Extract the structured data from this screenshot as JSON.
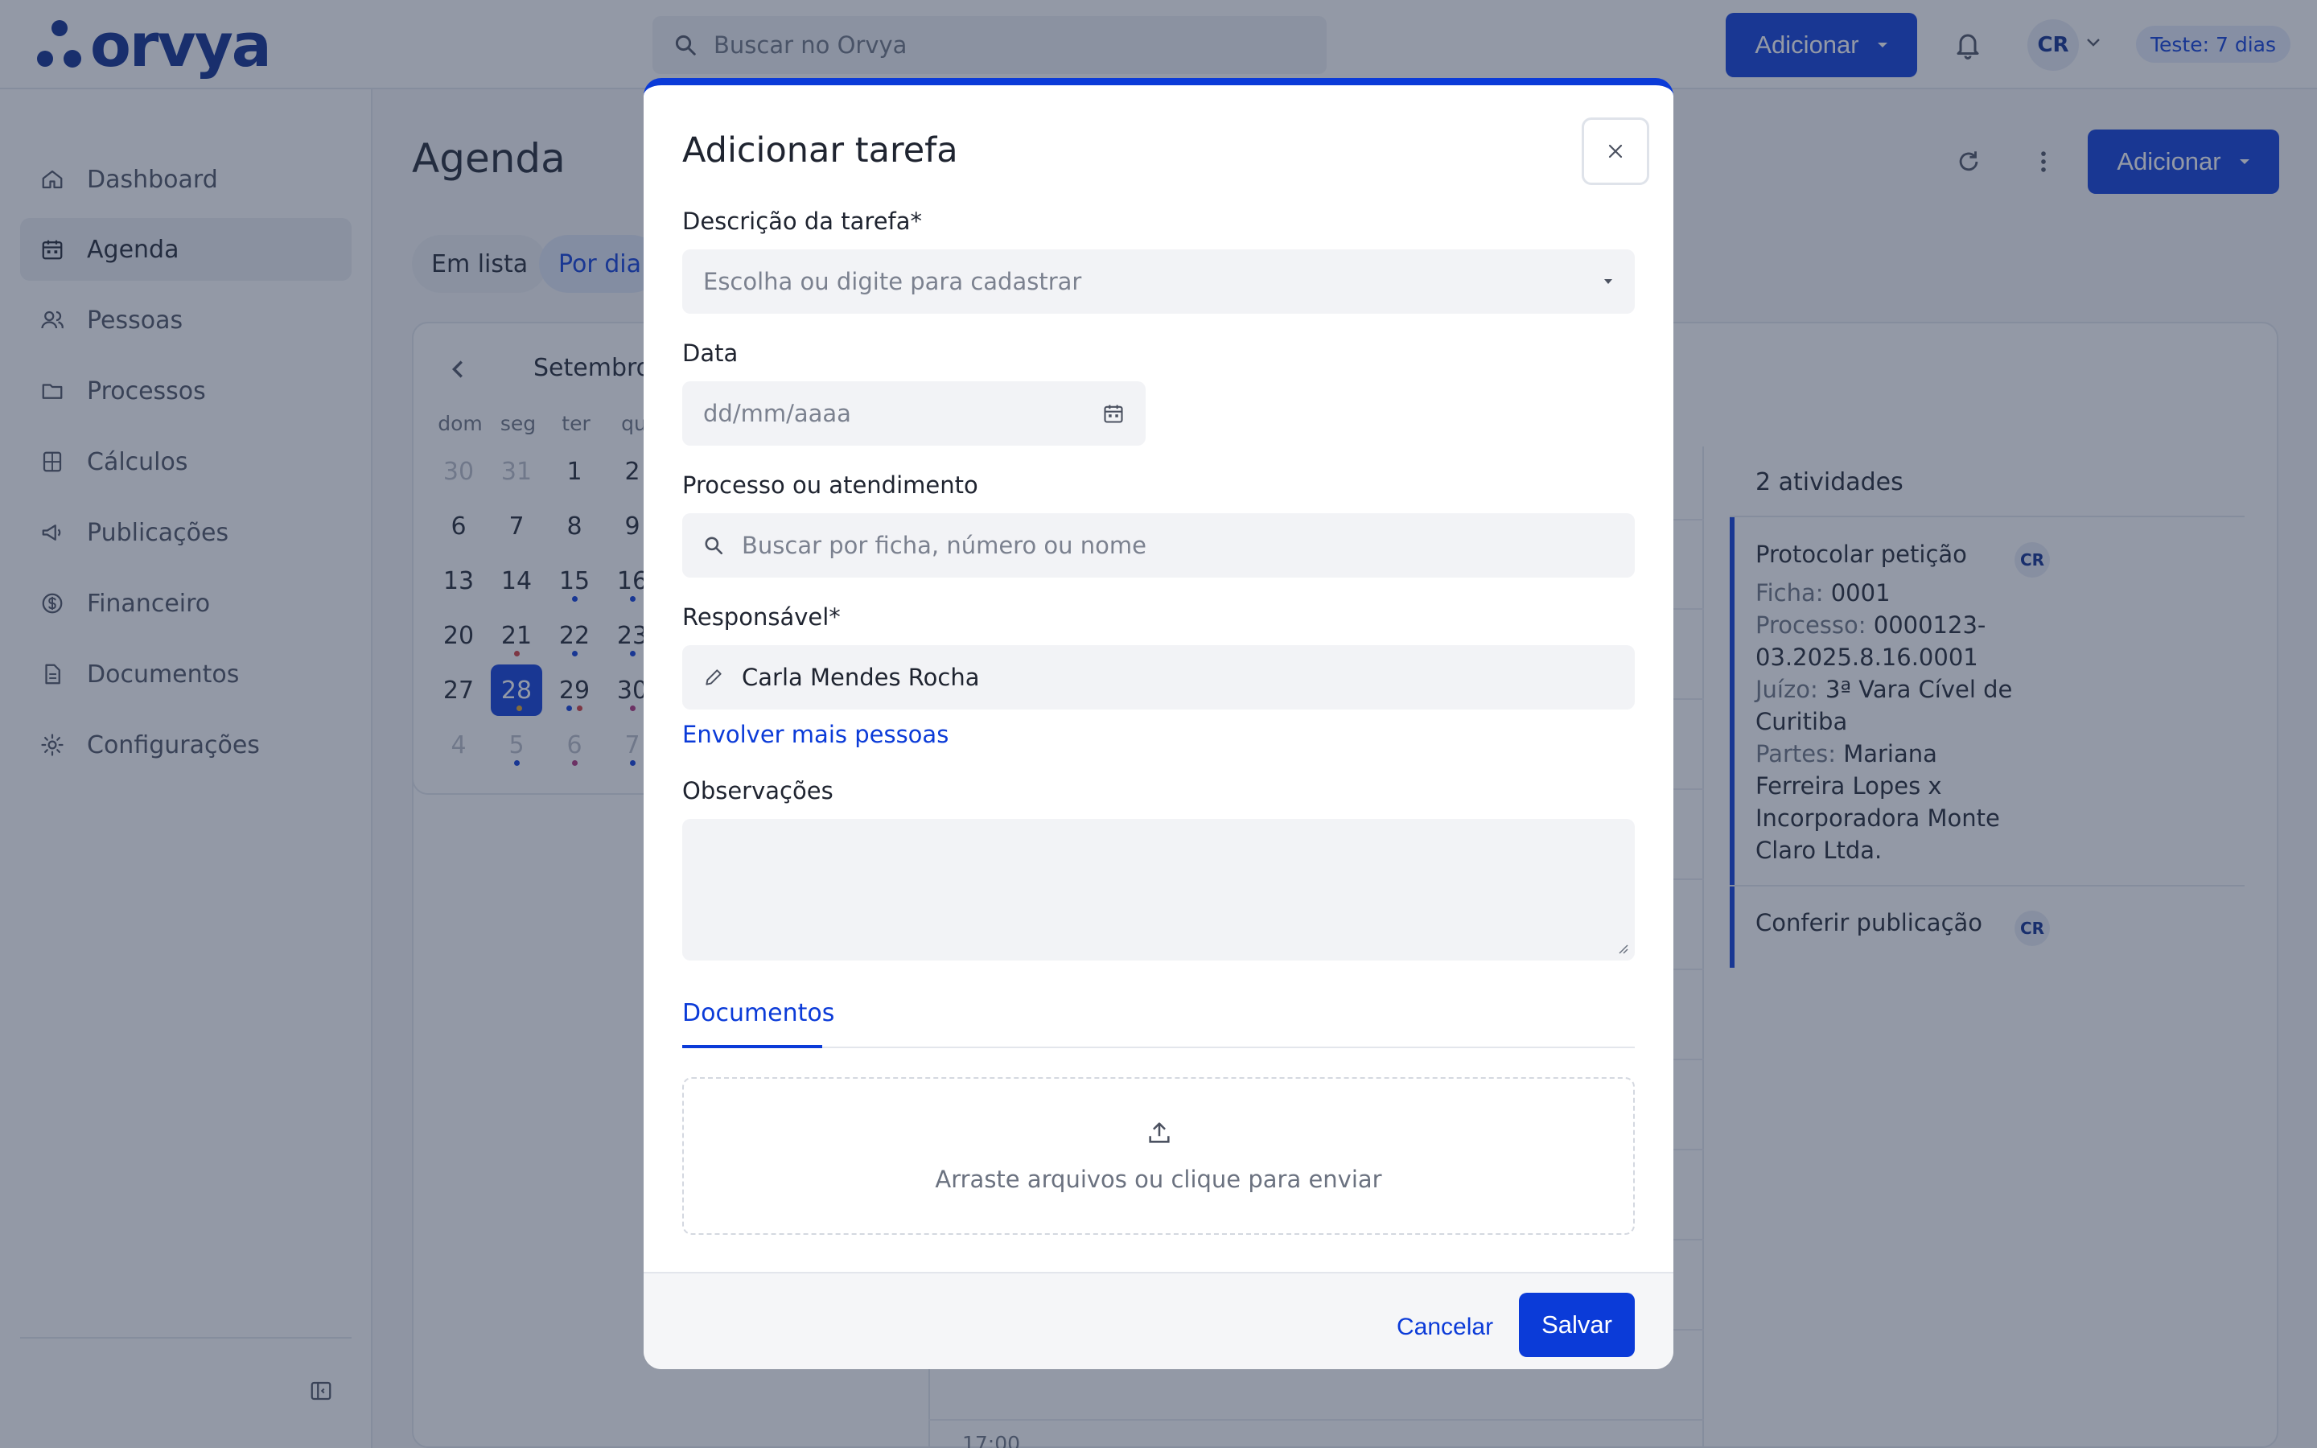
{
  "app": {
    "brand": "orvya",
    "search_placeholder": "Buscar no Orvya",
    "add_button": "Adicionar",
    "user_initials": "CR",
    "trial_badge": "Teste: 7 dias",
    "brand_color": "#0b3bd8"
  },
  "sidebar": {
    "items": [
      {
        "label": "Dashboard",
        "icon": "home-icon"
      },
      {
        "label": "Agenda",
        "icon": "calendar-icon",
        "active": true
      },
      {
        "label": "Pessoas",
        "icon": "users-icon"
      },
      {
        "label": "Processos",
        "icon": "folder-icon"
      },
      {
        "label": "Cálculos",
        "icon": "calculator-icon"
      },
      {
        "label": "Publicações",
        "icon": "megaphone-icon"
      },
      {
        "label": "Financeiro",
        "icon": "dollar-icon"
      },
      {
        "label": "Documentos",
        "icon": "document-icon"
      },
      {
        "label": "Configurações",
        "icon": "gear-icon"
      }
    ]
  },
  "agenda": {
    "title": "Agenda",
    "view_tabs": [
      "Em lista",
      "Por dia"
    ],
    "add_button": "Adicionar",
    "calendar": {
      "month": "Setembro",
      "weekdays": [
        "dom",
        "seg",
        "ter",
        "qu"
      ],
      "weeks": [
        [
          "30",
          "31",
          "1",
          "2"
        ],
        [
          "6",
          "7",
          "8",
          "9"
        ],
        [
          "13",
          "14",
          "15",
          "16"
        ],
        [
          "20",
          "21",
          "22",
          "23"
        ],
        [
          "27",
          "28",
          "29",
          "30"
        ],
        [
          "4",
          "5",
          "6",
          "7"
        ]
      ],
      "selected_day": "28"
    },
    "hour_label": "17:00",
    "activities": {
      "count_label": "2 atividades",
      "items": [
        {
          "title": "Protocolar petição",
          "badge": "CR",
          "details": [
            {
              "key": "Ficha:",
              "value": "0001"
            },
            {
              "key": "Processo:",
              "value": "0000123-03.2025.8.16.0001"
            },
            {
              "key": "Juízo:",
              "value": "3ª Vara Cível de Curitiba"
            },
            {
              "key": "Partes:",
              "value": "Mariana Ferreira Lopes x Incorporadora Monte Claro Ltda."
            }
          ]
        },
        {
          "title": "Conferir publicação",
          "badge": "CR"
        }
      ]
    }
  },
  "modal": {
    "title": "Adicionar tarefa",
    "fields": {
      "description": {
        "label": "Descrição da tarefa*",
        "placeholder": "Escolha ou digite para cadastrar"
      },
      "date": {
        "label": "Data",
        "placeholder": "dd/mm/aaaa"
      },
      "process": {
        "label": "Processo ou atendimento",
        "placeholder": "Buscar por ficha, número ou nome"
      },
      "responsible": {
        "label": "Responsável*",
        "value": "Carla Mendes Rocha"
      },
      "notes": {
        "label": "Observações",
        "value": ""
      }
    },
    "involve_link": "Envolver mais pessoas",
    "tab_documents": "Documentos",
    "upload_text": "Arraste arquivos ou clique para enviar",
    "cancel": "Cancelar",
    "save": "Salvar"
  }
}
